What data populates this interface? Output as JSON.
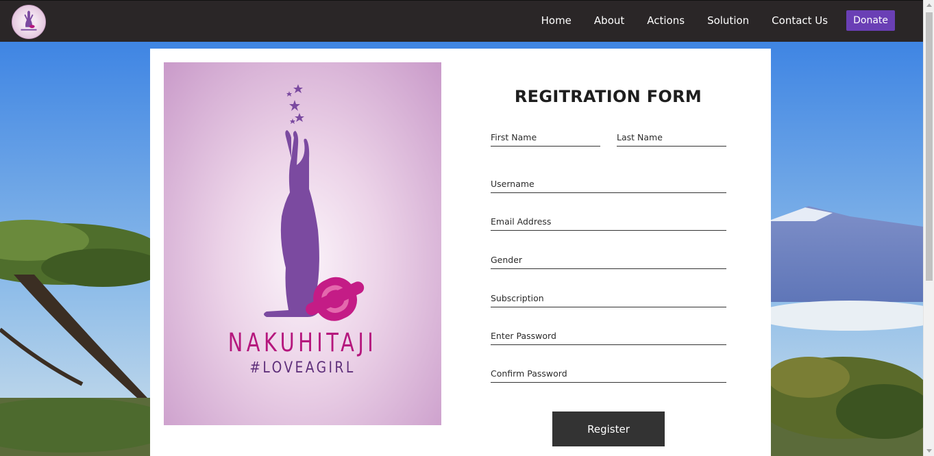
{
  "nav": {
    "items": [
      "Home",
      "About",
      "Actions",
      "Solution",
      "Contact Us"
    ],
    "donate_label": "Donate"
  },
  "poster": {
    "title": "NAKUHITAJI",
    "tagline": "#LOVEAGIRL"
  },
  "form": {
    "title": "REGITRATION FORM",
    "first_name_placeholder": "First Name",
    "last_name_placeholder": "Last Name",
    "username_placeholder": "Username",
    "email_placeholder": "Email Address",
    "gender_placeholder": "Gender",
    "subscription_placeholder": "Subscription",
    "password_placeholder": "Enter Password",
    "confirm_password_placeholder": "Confirm Password",
    "register_label": "Register"
  },
  "colors": {
    "navbar": "#2a2627",
    "donate": "#6a3fb5",
    "brand_magenta": "#b5177d",
    "brand_purple": "#7b4aa0",
    "register_button": "#333333"
  },
  "icons": {
    "logo": "nakuhitaji-logo-icon"
  }
}
